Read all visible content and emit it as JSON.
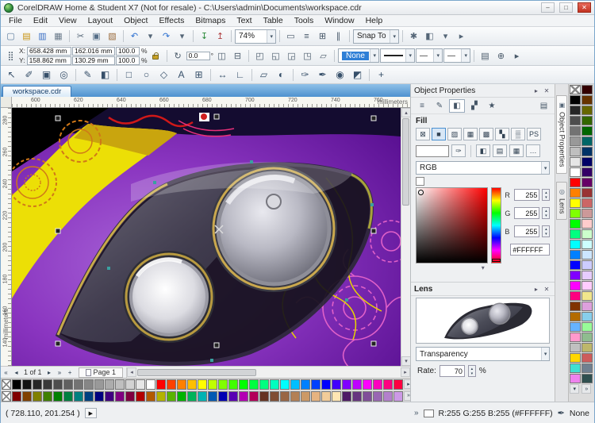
{
  "window": {
    "title": "CorelDRAW Home & Student X7 (Not for resale) - C:\\Users\\admin\\Documents\\workspace.cdr",
    "minimize": "–",
    "maximize": "□",
    "close": "✕"
  },
  "icons": {
    "dropdown": "▾",
    "up": "▴",
    "left": "◂",
    "overflow": "▸",
    "menu": "▸",
    "close": "✕",
    "double_chevron": "»",
    "play": "▶",
    "pen": "✒",
    "dash": "—",
    "anchor": "⣿",
    "rotate": "↻",
    "collapse": "▾"
  },
  "menu": {
    "items": [
      "File",
      "Edit",
      "View",
      "Layout",
      "Object",
      "Effects",
      "Bitmaps",
      "Text",
      "Table",
      "Tools",
      "Window",
      "Help"
    ]
  },
  "standard_toolbar": {
    "zoom_level": "74%",
    "snap_label": "Snap To",
    "left_buttons": [
      {
        "n": "new-document-button",
        "g": "▢",
        "c": "#5a7b9c"
      },
      {
        "n": "open-button",
        "g": "▤",
        "c": "#c8920e"
      },
      {
        "n": "save-button",
        "g": "▥",
        "c": "#3a6fc4"
      },
      {
        "n": "print-button",
        "g": "▦",
        "c": "#6a7a8a"
      },
      {
        "sep": true
      },
      {
        "n": "cut-button",
        "g": "✂",
        "c": "#556677"
      },
      {
        "n": "copy-button",
        "g": "▣",
        "c": "#556e88"
      },
      {
        "n": "paste-button",
        "g": "▧",
        "c": "#9a6a3a"
      },
      {
        "sep": true
      },
      {
        "n": "undo-button",
        "g": "↶",
        "c": "#2a6fd0"
      },
      {
        "n": "undo-dropdown",
        "g": "▾",
        "c": "#567"
      },
      {
        "n": "redo-button",
        "g": "↷",
        "c": "#2a6fd0"
      },
      {
        "n": "redo-dropdown",
        "g": "▾",
        "c": "#567"
      },
      {
        "sep": true
      },
      {
        "n": "import-button",
        "g": "↧",
        "c": "#2a8a3a"
      },
      {
        "n": "export-button",
        "g": "↥",
        "c": "#b04040"
      },
      {
        "sep": true
      }
    ],
    "mid_buttons": [
      {
        "sep": true
      },
      {
        "n": "fullscreen-preview-button",
        "g": "▭",
        "c": "#456"
      },
      {
        "n": "show-rulers-button",
        "g": "≡",
        "c": "#456"
      },
      {
        "n": "show-grid-button",
        "g": "⊞",
        "c": "#456"
      },
      {
        "n": "show-guidelines-button",
        "g": "∥",
        "c": "#456"
      },
      {
        "sep": true
      }
    ],
    "right_buttons": [
      {
        "sep": true
      },
      {
        "n": "options-button",
        "g": "✱",
        "c": "#567"
      },
      {
        "n": "application-launcher-button",
        "g": "◧",
        "c": "#567"
      },
      {
        "n": "launcher-dropdown",
        "g": "▾",
        "c": "#567"
      },
      {
        "n": "toolbar-overflow",
        "g": "▸",
        "c": "#567"
      }
    ]
  },
  "property_bar": {
    "x_label": "X:",
    "x_value": "658.428 mm",
    "y_label": "Y:",
    "y_value": "158.862 mm",
    "width_value": "162.016 mm",
    "height_value": "130.29 mm",
    "scale_w": "100.0",
    "scale_h": "100.0",
    "percent_label": "%",
    "angle_value": "0.0",
    "degree_label": "°",
    "outline_width": "None",
    "mirror_buttons": [
      {
        "n": "mirror-horizontal-button",
        "g": "◫"
      },
      {
        "n": "mirror-vertical-button",
        "g": "⊟"
      },
      {
        "sep": true
      }
    ],
    "object_buttons": [
      {
        "n": "to-front-button",
        "g": "◰"
      },
      {
        "n": "to-back-button",
        "g": "◱"
      },
      {
        "n": "group-button",
        "g": "◲"
      },
      {
        "n": "ungroup-button",
        "g": "◳"
      },
      {
        "n": "convert-to-curves-button",
        "g": "▱"
      },
      {
        "sep": true
      }
    ],
    "end_buttons": [
      {
        "sep": true
      },
      {
        "n": "wrap-text-button",
        "g": "▤"
      },
      {
        "n": "quick-customize-button",
        "g": "⊕"
      },
      {
        "n": "propbar-overflow",
        "g": "▸"
      }
    ]
  },
  "toolbox": {
    "tools": [
      {
        "n": "pick-tool",
        "g": "↖"
      },
      {
        "n": "shape-tool",
        "g": "✐"
      },
      {
        "n": "crop-tool",
        "g": "▣"
      },
      {
        "n": "zoom-tool",
        "g": "◎"
      },
      {
        "sep": true
      },
      {
        "n": "freehand-tool",
        "g": "✎"
      },
      {
        "n": "smart-fill-tool",
        "g": "◧"
      },
      {
        "sep": true
      },
      {
        "n": "rectangle-tool",
        "g": "□"
      },
      {
        "n": "ellipse-tool",
        "g": "○"
      },
      {
        "n": "polygon-tool",
        "g": "◇"
      },
      {
        "n": "text-tool",
        "g": "A"
      },
      {
        "n": "table-tool",
        "g": "⊞"
      },
      {
        "sep": true
      },
      {
        "n": "dimension-tool",
        "g": "↔"
      },
      {
        "n": "connector-tool",
        "g": "∟"
      },
      {
        "sep": true
      },
      {
        "n": "drop-shadow-tool",
        "g": "▱"
      },
      {
        "n": "transparency-tool",
        "g": "◐"
      },
      {
        "sep": true
      },
      {
        "n": "color-eyedropper-tool",
        "g": "✑"
      },
      {
        "n": "outline-pen-tool",
        "g": "✒"
      },
      {
        "n": "fill-tool",
        "g": "◉"
      },
      {
        "n": "interactive-fill-tool",
        "g": "◩"
      },
      {
        "sep": true
      },
      {
        "n": "customize-toolbox-button",
        "g": "+"
      }
    ]
  },
  "document_tabs": {
    "active": "workspace.cdr"
  },
  "rulers": {
    "unit": "millimeters",
    "horizontal": {
      "labels": [
        "600",
        "620",
        "640",
        "660",
        "680",
        "700",
        "720",
        "740",
        "760"
      ],
      "start": 24,
      "step": 54
    },
    "vertical": {
      "labels": [
        "280",
        "260",
        "240",
        "220",
        "200",
        "180",
        "160",
        "140"
      ],
      "start": 12,
      "step": 40
    }
  },
  "docker": {
    "title": "Object Properties",
    "tabs": [
      {
        "n": "docker-tab-summary",
        "g": "≡"
      },
      {
        "n": "docker-tab-outline",
        "g": "✎"
      },
      {
        "n": "docker-tab-fill",
        "g": "◧",
        "active": true
      },
      {
        "n": "docker-tab-transparency",
        "g": "▞"
      },
      {
        "n": "docker-tab-effects",
        "g": "★"
      },
      {
        "n": "docker-scroll-mode-button",
        "g": "▤"
      }
    ],
    "fill": {
      "label": "Fill",
      "types": [
        {
          "n": "no-fill-button",
          "g": "⊠"
        },
        {
          "n": "uniform-fill-button",
          "g": "■",
          "active": true
        },
        {
          "n": "fountain-fill-button",
          "g": "▨"
        },
        {
          "n": "vector-pattern-button",
          "g": "▦"
        },
        {
          "n": "bitmap-pattern-button",
          "g": "▩"
        },
        {
          "n": "two-color-pattern-button",
          "g": "▚"
        },
        {
          "n": "texture-fill-button",
          "g": "▒"
        },
        {
          "n": "postscript-fill-button",
          "g": "PS"
        }
      ],
      "swatch_buttons": [
        {
          "n": "eyedropper-button",
          "g": "✑"
        },
        {
          "sep": true
        },
        {
          "n": "color-viewers-button",
          "g": "◧"
        },
        {
          "n": "color-sliders-button",
          "g": "▤"
        },
        {
          "n": "color-palettes-button",
          "g": "▦"
        },
        {
          "n": "fill-options-button",
          "g": "…"
        }
      ],
      "color_model": "RGB",
      "r_label": "R",
      "r": "255",
      "g_label": "G",
      "g": "255",
      "b_label": "B",
      "b": "255",
      "hex": "#FFFFFF"
    },
    "lens": {
      "label": "Lens",
      "type": "Transparency",
      "rate_label": "Rate:",
      "rate": "70",
      "unit": "%"
    }
  },
  "side_tabs": {
    "a": "Object Properties",
    "icon_a": "▣",
    "b": "Lens",
    "icon_b": "◎"
  },
  "right_palette": {
    "column_a": [
      "#000000",
      "#262626",
      "#4d4d4d",
      "#737373",
      "#999999",
      "#bfbfbf",
      "#e6e6e6",
      "#ffffff",
      "#ff0000",
      "#ff8000",
      "#ffff00",
      "#80ff00",
      "#00ff00",
      "#00ff80",
      "#00ffff",
      "#0080ff",
      "#0000ff",
      "#8000ff",
      "#ff00ff",
      "#ff0080",
      "#803300",
      "#b36b00",
      "#66b3ff",
      "#ff99cc",
      "#c0c0c0",
      "#ffd700",
      "#40e0d0",
      "#ee82ee"
    ],
    "column_b": [
      "#330000",
      "#663300",
      "#666600",
      "#336600",
      "#006600",
      "#006666",
      "#003366",
      "#000066",
      "#330066",
      "#660066",
      "#993333",
      "#cc6666",
      "#cc9999",
      "#ffcccc",
      "#ccffcc",
      "#ccffff",
      "#cce6ff",
      "#ccccff",
      "#e6ccff",
      "#ffccff",
      "#f0e68c",
      "#dda0dd",
      "#87ceeb",
      "#98fb98",
      "#8fbc8f",
      "#bdb76b",
      "#cd5c5c",
      "#708090",
      "#2f4f4f"
    ]
  },
  "bottom_palette": {
    "row1": [
      "#000000",
      "#131313",
      "#262626",
      "#393939",
      "#4d4d4d",
      "#606060",
      "#737373",
      "#868686",
      "#999999",
      "#acacac",
      "#bfbfbf",
      "#d2d2d2",
      "#e6e6e6",
      "#ffffff",
      "#ff0000",
      "#ff4000",
      "#ff8000",
      "#ffbf00",
      "#ffff00",
      "#bfff00",
      "#80ff00",
      "#40ff00",
      "#00ff00",
      "#00ff40",
      "#00ff80",
      "#00ffbf",
      "#00ffff",
      "#00bfff",
      "#0080ff",
      "#0040ff",
      "#0000ff",
      "#4000ff",
      "#8000ff",
      "#bf00ff",
      "#ff00ff",
      "#ff00bf",
      "#ff0080",
      "#ff0040"
    ],
    "row2": [
      "#800000",
      "#804000",
      "#808000",
      "#408000",
      "#008000",
      "#008040",
      "#008080",
      "#004080",
      "#000080",
      "#400080",
      "#800080",
      "#800040",
      "#b30000",
      "#b35900",
      "#b3b300",
      "#59b300",
      "#00b300",
      "#00b359",
      "#00b3b3",
      "#0059b3",
      "#0000b3",
      "#5900b3",
      "#b300b3",
      "#b30059",
      "#663322",
      "#804d33",
      "#996644",
      "#b38055",
      "#cc9966",
      "#e6b380",
      "#f2cc99",
      "#ffe6b3",
      "#4d1a66",
      "#663380",
      "#804d99",
      "#9966b3",
      "#b380cc",
      "#cc99e6"
    ]
  },
  "page_nav": {
    "first": "«",
    "prev": "◂",
    "label": "1 of 1",
    "next": "▸",
    "last": "»",
    "add": "+",
    "page_tab": "Page 1"
  },
  "status_bar": {
    "cursor_position": "( 728.110, 201.254 )",
    "fill_label": "R:255 G:255 B:255 (#FFFFFF)",
    "fill_color": "#FFFFFF",
    "outline_label": "None"
  }
}
